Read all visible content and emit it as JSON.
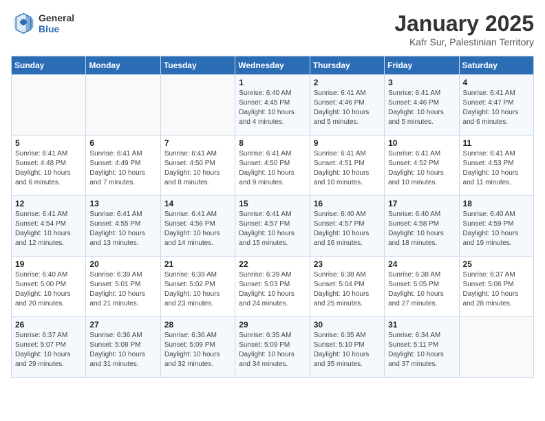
{
  "header": {
    "logo_general": "General",
    "logo_blue": "Blue",
    "month_title": "January 2025",
    "subtitle": "Kafr Sur, Palestinian Territory"
  },
  "days_of_week": [
    "Sunday",
    "Monday",
    "Tuesday",
    "Wednesday",
    "Thursday",
    "Friday",
    "Saturday"
  ],
  "weeks": [
    [
      {
        "day": "",
        "sunrise": "",
        "sunset": "",
        "daylight": ""
      },
      {
        "day": "",
        "sunrise": "",
        "sunset": "",
        "daylight": ""
      },
      {
        "day": "",
        "sunrise": "",
        "sunset": "",
        "daylight": ""
      },
      {
        "day": "1",
        "sunrise": "Sunrise: 6:40 AM",
        "sunset": "Sunset: 4:45 PM",
        "daylight": "Daylight: 10 hours and 4 minutes."
      },
      {
        "day": "2",
        "sunrise": "Sunrise: 6:41 AM",
        "sunset": "Sunset: 4:46 PM",
        "daylight": "Daylight: 10 hours and 5 minutes."
      },
      {
        "day": "3",
        "sunrise": "Sunrise: 6:41 AM",
        "sunset": "Sunset: 4:46 PM",
        "daylight": "Daylight: 10 hours and 5 minutes."
      },
      {
        "day": "4",
        "sunrise": "Sunrise: 6:41 AM",
        "sunset": "Sunset: 4:47 PM",
        "daylight": "Daylight: 10 hours and 6 minutes."
      }
    ],
    [
      {
        "day": "5",
        "sunrise": "Sunrise: 6:41 AM",
        "sunset": "Sunset: 4:48 PM",
        "daylight": "Daylight: 10 hours and 6 minutes."
      },
      {
        "day": "6",
        "sunrise": "Sunrise: 6:41 AM",
        "sunset": "Sunset: 4:49 PM",
        "daylight": "Daylight: 10 hours and 7 minutes."
      },
      {
        "day": "7",
        "sunrise": "Sunrise: 6:41 AM",
        "sunset": "Sunset: 4:50 PM",
        "daylight": "Daylight: 10 hours and 8 minutes."
      },
      {
        "day": "8",
        "sunrise": "Sunrise: 6:41 AM",
        "sunset": "Sunset: 4:50 PM",
        "daylight": "Daylight: 10 hours and 9 minutes."
      },
      {
        "day": "9",
        "sunrise": "Sunrise: 6:41 AM",
        "sunset": "Sunset: 4:51 PM",
        "daylight": "Daylight: 10 hours and 10 minutes."
      },
      {
        "day": "10",
        "sunrise": "Sunrise: 6:41 AM",
        "sunset": "Sunset: 4:52 PM",
        "daylight": "Daylight: 10 hours and 10 minutes."
      },
      {
        "day": "11",
        "sunrise": "Sunrise: 6:41 AM",
        "sunset": "Sunset: 4:53 PM",
        "daylight": "Daylight: 10 hours and 11 minutes."
      }
    ],
    [
      {
        "day": "12",
        "sunrise": "Sunrise: 6:41 AM",
        "sunset": "Sunset: 4:54 PM",
        "daylight": "Daylight: 10 hours and 12 minutes."
      },
      {
        "day": "13",
        "sunrise": "Sunrise: 6:41 AM",
        "sunset": "Sunset: 4:55 PM",
        "daylight": "Daylight: 10 hours and 13 minutes."
      },
      {
        "day": "14",
        "sunrise": "Sunrise: 6:41 AM",
        "sunset": "Sunset: 4:56 PM",
        "daylight": "Daylight: 10 hours and 14 minutes."
      },
      {
        "day": "15",
        "sunrise": "Sunrise: 6:41 AM",
        "sunset": "Sunset: 4:57 PM",
        "daylight": "Daylight: 10 hours and 15 minutes."
      },
      {
        "day": "16",
        "sunrise": "Sunrise: 6:40 AM",
        "sunset": "Sunset: 4:57 PM",
        "daylight": "Daylight: 10 hours and 16 minutes."
      },
      {
        "day": "17",
        "sunrise": "Sunrise: 6:40 AM",
        "sunset": "Sunset: 4:58 PM",
        "daylight": "Daylight: 10 hours and 18 minutes."
      },
      {
        "day": "18",
        "sunrise": "Sunrise: 6:40 AM",
        "sunset": "Sunset: 4:59 PM",
        "daylight": "Daylight: 10 hours and 19 minutes."
      }
    ],
    [
      {
        "day": "19",
        "sunrise": "Sunrise: 6:40 AM",
        "sunset": "Sunset: 5:00 PM",
        "daylight": "Daylight: 10 hours and 20 minutes."
      },
      {
        "day": "20",
        "sunrise": "Sunrise: 6:39 AM",
        "sunset": "Sunset: 5:01 PM",
        "daylight": "Daylight: 10 hours and 21 minutes."
      },
      {
        "day": "21",
        "sunrise": "Sunrise: 6:39 AM",
        "sunset": "Sunset: 5:02 PM",
        "daylight": "Daylight: 10 hours and 23 minutes."
      },
      {
        "day": "22",
        "sunrise": "Sunrise: 6:39 AM",
        "sunset": "Sunset: 5:03 PM",
        "daylight": "Daylight: 10 hours and 24 minutes."
      },
      {
        "day": "23",
        "sunrise": "Sunrise: 6:38 AM",
        "sunset": "Sunset: 5:04 PM",
        "daylight": "Daylight: 10 hours and 25 minutes."
      },
      {
        "day": "24",
        "sunrise": "Sunrise: 6:38 AM",
        "sunset": "Sunset: 5:05 PM",
        "daylight": "Daylight: 10 hours and 27 minutes."
      },
      {
        "day": "25",
        "sunrise": "Sunrise: 6:37 AM",
        "sunset": "Sunset: 5:06 PM",
        "daylight": "Daylight: 10 hours and 28 minutes."
      }
    ],
    [
      {
        "day": "26",
        "sunrise": "Sunrise: 6:37 AM",
        "sunset": "Sunset: 5:07 PM",
        "daylight": "Daylight: 10 hours and 29 minutes."
      },
      {
        "day": "27",
        "sunrise": "Sunrise: 6:36 AM",
        "sunset": "Sunset: 5:08 PM",
        "daylight": "Daylight: 10 hours and 31 minutes."
      },
      {
        "day": "28",
        "sunrise": "Sunrise: 6:36 AM",
        "sunset": "Sunset: 5:09 PM",
        "daylight": "Daylight: 10 hours and 32 minutes."
      },
      {
        "day": "29",
        "sunrise": "Sunrise: 6:35 AM",
        "sunset": "Sunset: 5:09 PM",
        "daylight": "Daylight: 10 hours and 34 minutes."
      },
      {
        "day": "30",
        "sunrise": "Sunrise: 6:35 AM",
        "sunset": "Sunset: 5:10 PM",
        "daylight": "Daylight: 10 hours and 35 minutes."
      },
      {
        "day": "31",
        "sunrise": "Sunrise: 6:34 AM",
        "sunset": "Sunset: 5:11 PM",
        "daylight": "Daylight: 10 hours and 37 minutes."
      },
      {
        "day": "",
        "sunrise": "",
        "sunset": "",
        "daylight": ""
      }
    ]
  ]
}
